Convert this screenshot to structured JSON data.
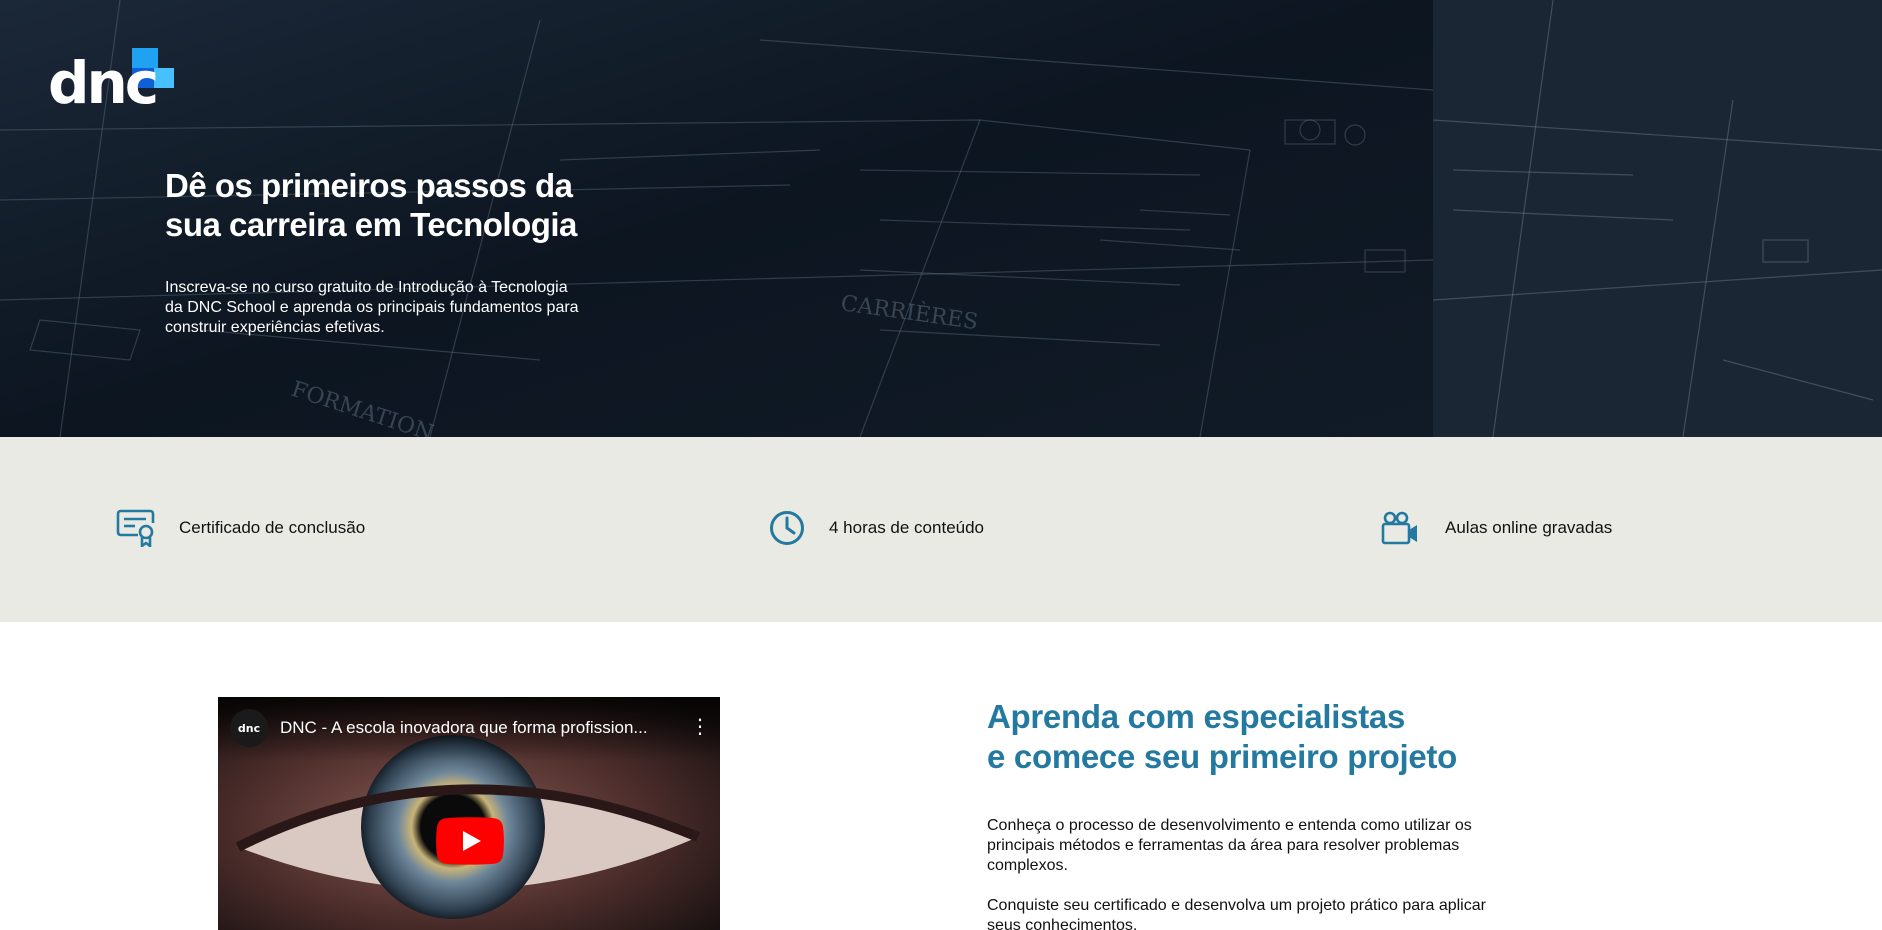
{
  "brand": {
    "logo_text": "dnc",
    "colors": {
      "accent_light": "#46c0ff",
      "accent": "#1fa2f2",
      "accent_dark": "#0f5fd8",
      "heading_blue": "#23799f"
    }
  },
  "hero": {
    "title_line1": "Dê os primeiros passos da",
    "title_line2": "sua carreira em Tecnologia",
    "description": "Inscreva-se no curso gratuito de Introdução à Tecnologia da DNC School e aprenda os principais fundamentos para construir experiências efetivas.",
    "sketch_words": [
      "CARRIÈRES",
      "FORMATION"
    ]
  },
  "features": [
    {
      "icon": "certificate-icon",
      "label": "Certificado de conclusão"
    },
    {
      "icon": "clock-icon",
      "label": "4 horas de conteúdo"
    },
    {
      "icon": "video-camera-icon",
      "label": "Aulas online gravadas"
    }
  ],
  "video": {
    "channel_avatar": "dnc",
    "title": "DNC - A escola inovadora que forma profission...",
    "menu_icon": "more-vertical-icon",
    "play_icon": "youtube-play-icon"
  },
  "learn": {
    "title_line1": "Aprenda com especialistas",
    "title_line2": "e comece seu primeiro projeto",
    "paragraph1": "Conheça o processo de desenvolvimento e entenda como utilizar os principais métodos e ferramentas da área para resolver problemas complexos.",
    "paragraph2": "Conquiste seu certificado e desenvolva um projeto prático para aplicar seus conhecimentos."
  }
}
